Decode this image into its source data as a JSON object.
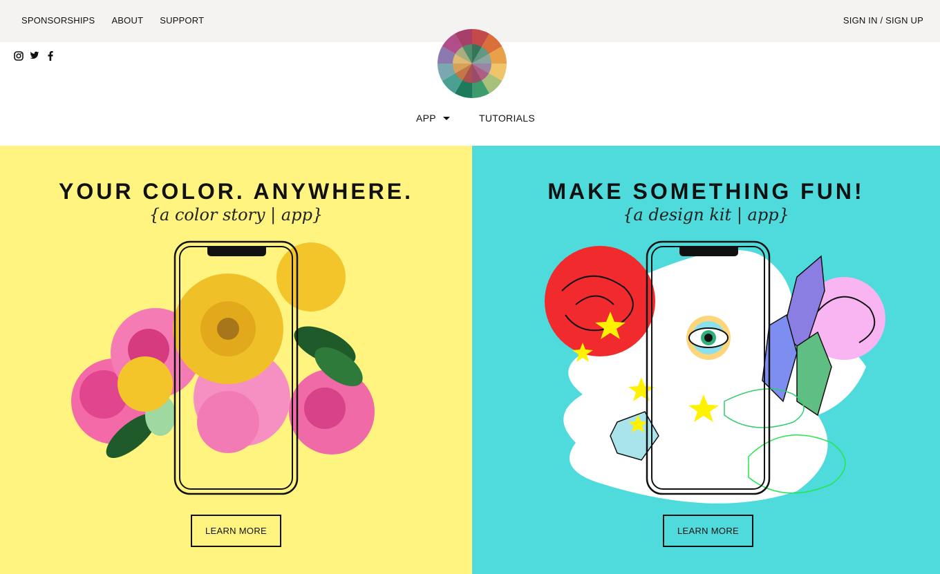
{
  "topbar": {
    "nav": [
      "SPONSORSHIPS",
      "ABOUT",
      "SUPPORT"
    ],
    "signin": "SIGN IN / SIGN UP"
  },
  "social": {
    "icons": [
      "instagram-icon",
      "twitter-icon",
      "facebook-icon"
    ]
  },
  "mainnav": {
    "app": "APP",
    "tutorials": "TUTORIALS"
  },
  "panels": [
    {
      "title": "YOUR COLOR. ANYWHERE.",
      "subtitle": "{a color story | app}",
      "button": "LEARN MORE",
      "background": "#fff47f"
    },
    {
      "title": "MAKE SOMETHING FUN!",
      "subtitle": "{a design kit | app}",
      "button": "LEARN MORE",
      "background": "#4fdadc"
    }
  ],
  "colors": {
    "topbar": "#f4f3f1",
    "text": "#111111"
  }
}
